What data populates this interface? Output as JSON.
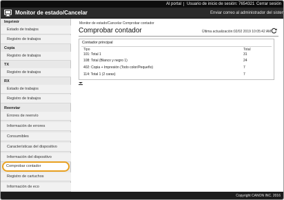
{
  "topbar": {
    "portal": "Al portal",
    "user_label": "Usuario de inicio de sesión:",
    "user_id": "7654321",
    "logout": "Cerrar sesión"
  },
  "header": {
    "title": "Monitor de estado/Cancelar",
    "mail_admin": "Enviar correo al administrador del sistema",
    "logo_icon": "monitor-logo-icon"
  },
  "sidebar": {
    "sections": [
      {
        "heading": "Imprimir",
        "items": [
          "Estado de trabajos",
          "Registro de trabajos"
        ]
      },
      {
        "heading": "Copia",
        "items": [
          "Registro de trabajos"
        ]
      },
      {
        "heading": "TX",
        "items": [
          "Registro de trabajos"
        ]
      },
      {
        "heading": "RX",
        "items": [
          "Estado de trabajos",
          "Registro de trabajos"
        ]
      },
      {
        "heading": "Reenviar",
        "items": [
          "Errores de reenvío",
          "Información de errores",
          "Consumibles",
          "Características del dispositivo",
          "Información del dispositivo",
          "Comprobar contador",
          "Registro de cartuchos",
          "Información de eco"
        ]
      }
    ],
    "active_item": "Comprobar contador",
    "highlight_color": "#e8a020"
  },
  "main": {
    "breadcrumb": "Monitor de estado/Cancelar  Comprobar contador",
    "title": "Comprobar contador",
    "last_update": "Última actualización:02/02 2019 10:05:42 AM",
    "panel": {
      "title": "Contador principal",
      "col_type": "Tipo",
      "col_total": "Total",
      "rows": [
        {
          "type": "101: Total 1",
          "total": "31"
        },
        {
          "type": "108: Total (Blanco y negro 1)",
          "total": "24"
        },
        {
          "type": "402: Copia + Impresión (Todo color/Pequeño)",
          "total": "7"
        },
        {
          "type": "114: Total 1 (2 caras)",
          "total": "7"
        }
      ]
    }
  },
  "footer": {
    "copyright": "Copyright CANON INC. 2016"
  }
}
